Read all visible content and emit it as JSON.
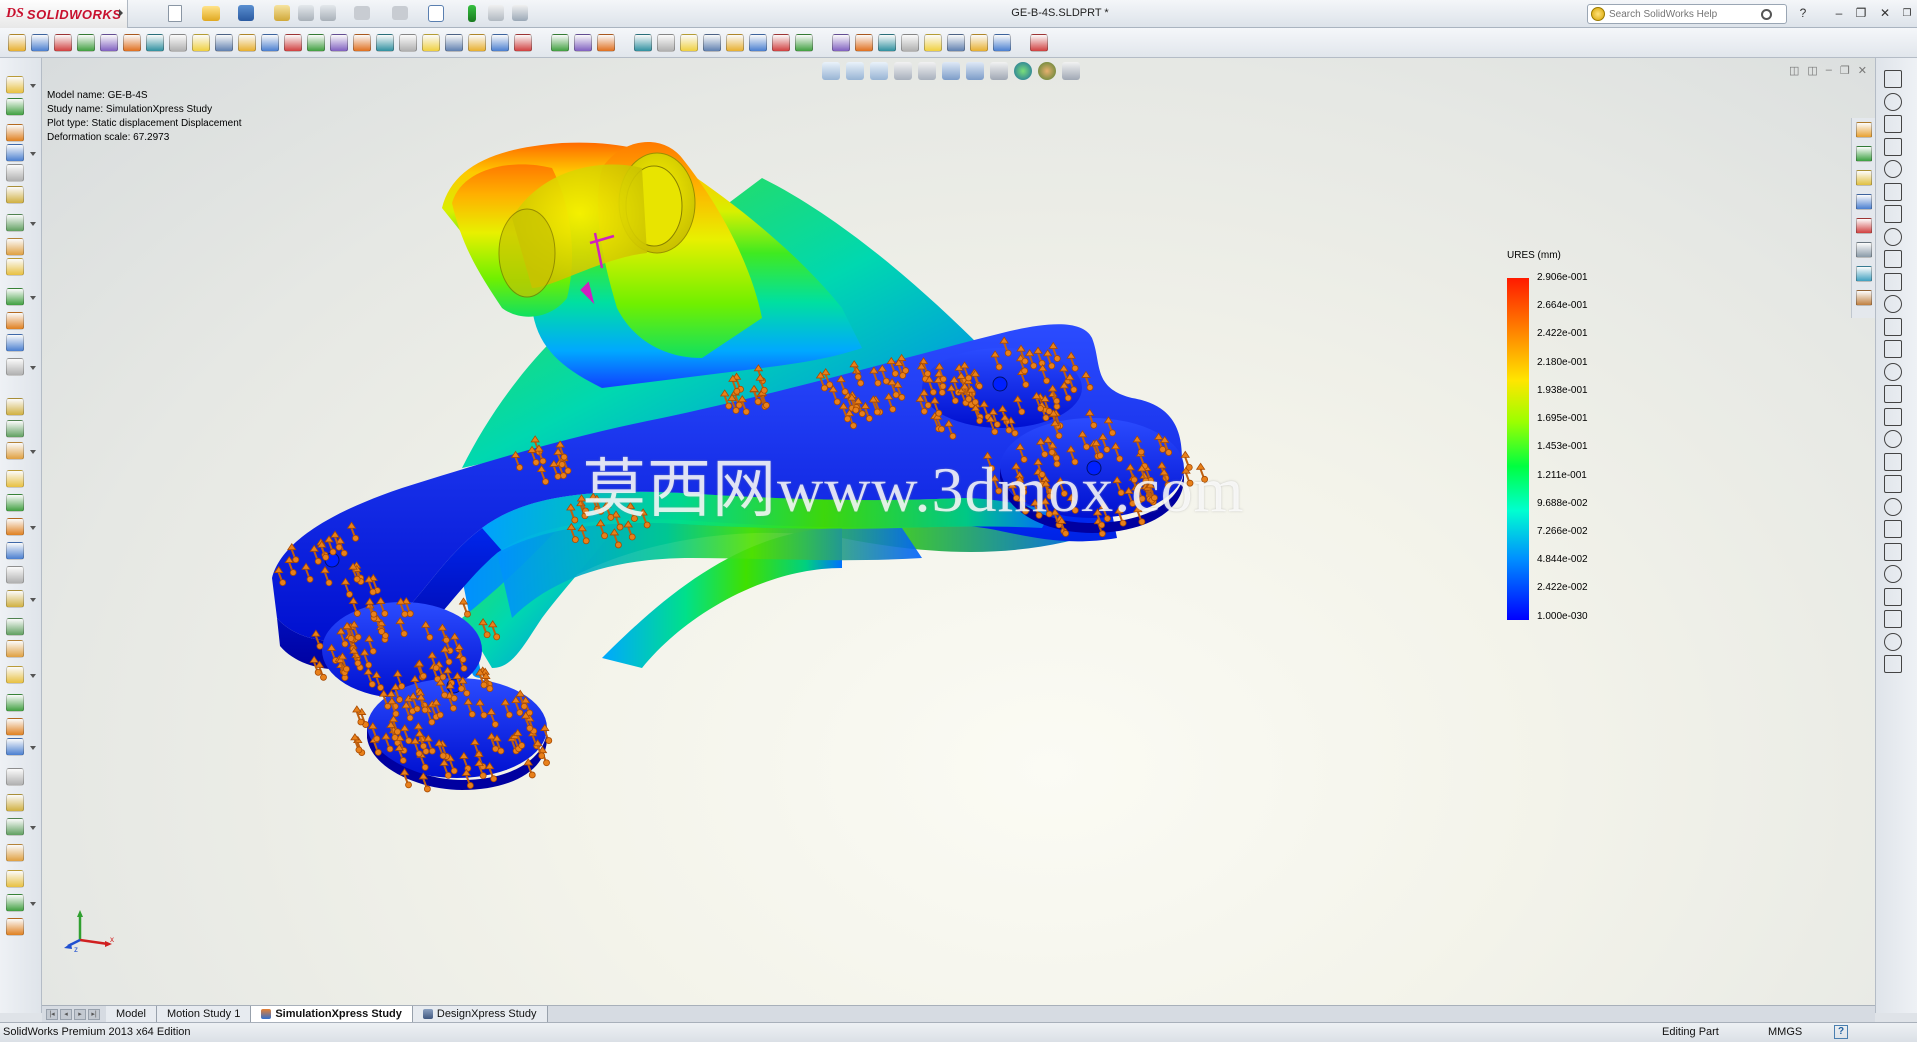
{
  "app": {
    "brand_prefix": "DS",
    "brand_name": "SOLIDWORKS",
    "document_title": "GE-B-4S.SLDPRT *",
    "help_search_placeholder": "Search SolidWorks Help"
  },
  "study_info": {
    "model_name": "Model name: GE-B-4S",
    "study_name": "Study name: SimulationXpress Study",
    "plot_type": "Plot type: Static displacement Displacement",
    "deformation_scale": "Deformation scale: 67.2973"
  },
  "legend": {
    "title": "URES (mm)",
    "labels": [
      "2.906e-001",
      "2.664e-001",
      "2.422e-001",
      "2.180e-001",
      "1.938e-001",
      "1.695e-001",
      "1.453e-001",
      "1.211e-001",
      "9.688e-002",
      "7.266e-002",
      "4.844e-002",
      "2.422e-002",
      "1.000e-030"
    ],
    "colors": [
      "#ff1a00",
      "#ff8000",
      "#ffe600",
      "#9cff00",
      "#00ff40",
      "#00ffd0",
      "#0090ff",
      "#0000ff"
    ]
  },
  "watermark": "莫西网www.3dmox.com",
  "tabs": [
    {
      "label": "Model"
    },
    {
      "label": "Motion Study 1"
    },
    {
      "label": "SimulationXpress Study"
    },
    {
      "label": "DesignXpress Study"
    }
  ],
  "active_tab": "SimulationXpress Study",
  "status": {
    "edition": "SolidWorks Premium 2013 x64 Edition",
    "mode": "Editing Part",
    "units": "MMGS",
    "help_glyph": "?"
  },
  "window_controls": {
    "minimize": "–",
    "restore": "❐",
    "close": "✕",
    "help": "?"
  }
}
